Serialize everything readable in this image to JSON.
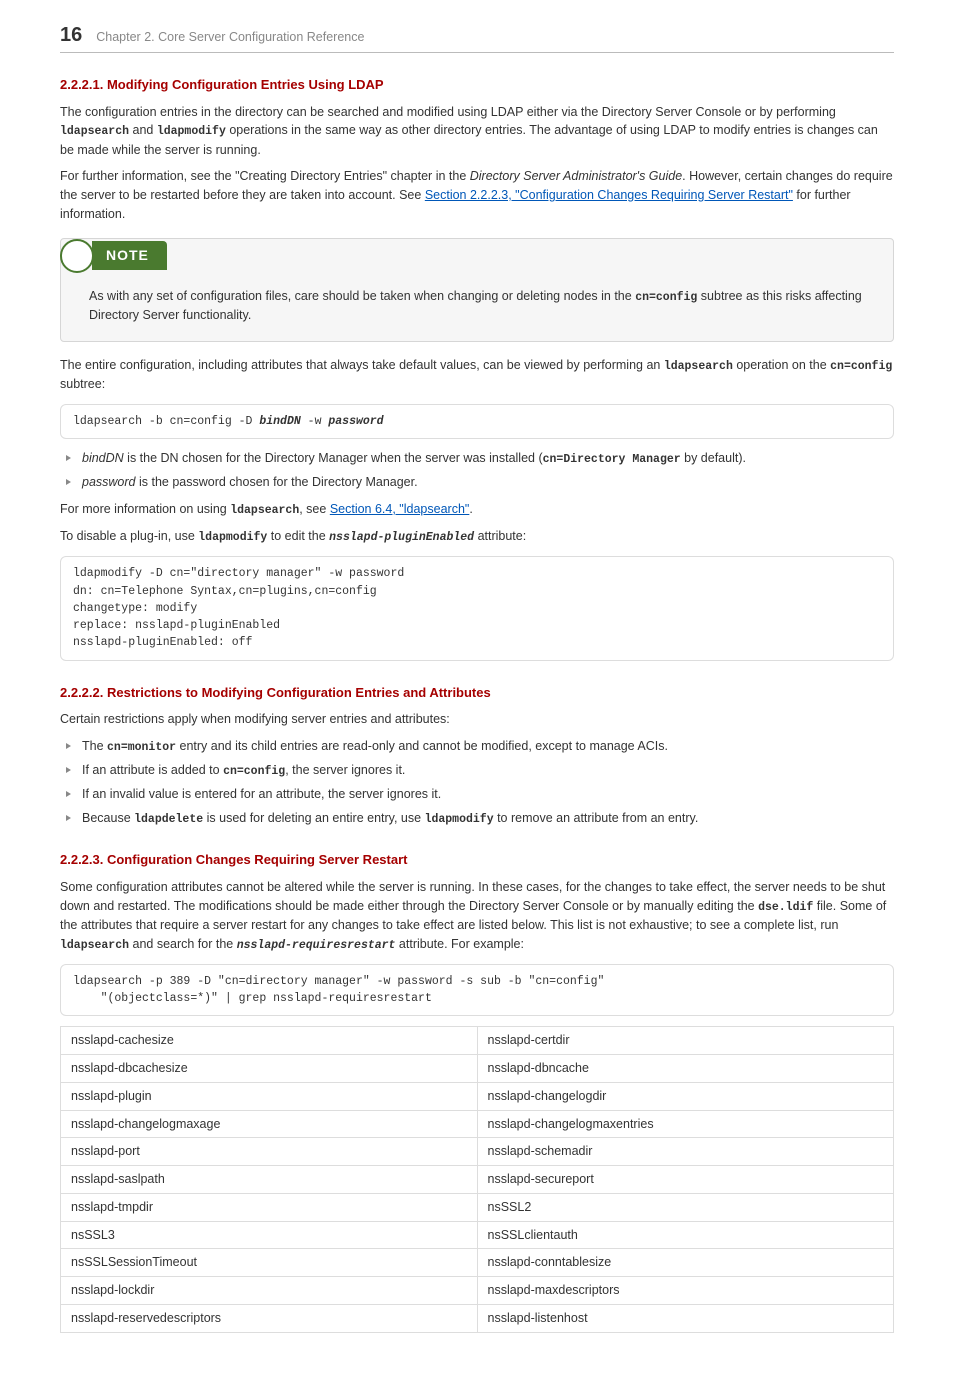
{
  "header": {
    "page_number": "16",
    "chapter": "Chapter 2. Core Server Configuration Reference"
  },
  "s1": {
    "title": "2.2.2.1. Modifying Configuration Entries Using LDAP",
    "p1a": "The configuration entries in the directory can be searched and modified using LDAP either via the Directory Server Console or by performing ",
    "p1b": "ldapsearch",
    "p1c": " and ",
    "p1d": "ldapmodify",
    "p1e": " operations in the same way as other directory entries. The advantage of using LDAP to modify entries is changes can be made while the server is running.",
    "p2a": "For further information, see the \"Creating Directory Entries\" chapter in the ",
    "p2b": "Directory Server Administrator's Guide",
    "p2c": ". However, certain changes do require the server to be restarted before they are taken into account. See ",
    "p2link": "Section 2.2.2.3, \"Configuration Changes Requiring Server Restart\"",
    "p2d": " for further information.",
    "note_label": "NOTE",
    "note_a": "As with any set of configuration files, care should be taken when changing or deleting nodes in the ",
    "note_b": "cn=config",
    "note_c": " subtree as this risks affecting Directory Server functionality.",
    "p3a": "The entire configuration, including attributes that always take default values, can be viewed by performing an ",
    "p3b": "ldapsearch",
    "p3c": " operation on the ",
    "p3d": "cn=config",
    "p3e": " subtree:",
    "code1a": "ldapsearch -b cn=config -D ",
    "code1b": "bindDN",
    "code1c": " -w ",
    "code1d": "password",
    "li1a": "bindDN",
    "li1b": " is the DN chosen for the Directory Manager when the server was installed (",
    "li1c": "cn=Directory Manager",
    "li1d": " by default).",
    "li2a": "password",
    "li2b": " is the password chosen for the Directory Manager.",
    "p4a": "For more information on using ",
    "p4b": "ldapsearch",
    "p4c": ", see ",
    "p4link": "Section 6.4, \"ldapsearch\"",
    "p4d": ".",
    "p5a": "To disable a plug-in, use ",
    "p5b": "ldapmodify",
    "p5c": " to edit the ",
    "p5d": "nsslapd-pluginEnabled",
    "p5e": " attribute:",
    "code2": "ldapmodify -D cn=\"directory manager\" -w password\ndn: cn=Telephone Syntax,cn=plugins,cn=config\nchangetype: modify\nreplace: nsslapd-pluginEnabled\nnsslapd-pluginEnabled: off"
  },
  "s2": {
    "title": "2.2.2.2. Restrictions to Modifying Configuration Entries and Attributes",
    "p1": "Certain restrictions apply when modifying server entries and attributes:",
    "li1a": "The ",
    "li1b": "cn=monitor",
    "li1c": " entry and its child entries are read-only and cannot be modified, except to manage ACIs.",
    "li2a": "If an attribute is added to ",
    "li2b": "cn=config",
    "li2c": ", the server ignores it.",
    "li3": "If an invalid value is entered for an attribute, the server ignores it.",
    "li4a": "Because ",
    "li4b": "ldapdelete",
    "li4c": " is used for deleting an entire entry, use ",
    "li4d": "ldapmodify",
    "li4e": " to remove an attribute from an entry."
  },
  "s3": {
    "title": "2.2.2.3. Configuration Changes Requiring Server Restart",
    "p1a": "Some configuration attributes cannot be altered while the server is running. In these cases, for the changes to take effect, the server needs to be shut down and restarted. The modifications should be made either through the Directory Server Console or by manually editing the ",
    "p1b": "dse.ldif",
    "p1c": " file. Some of the attributes that require a server restart for any changes to take effect are listed below. This list is not exhaustive; to see a complete list, run ",
    "p1d": "ldapsearch",
    "p1e": " and search for the ",
    "p1f": "nsslapd-requiresrestart",
    "p1g": " attribute. For example:",
    "code1": "ldapsearch -p 389 -D \"cn=directory manager\" -w password -s sub -b \"cn=config\"\n    \"(objectclass=*)\" | grep nsslapd-requiresrestart",
    "table": [
      [
        "nsslapd-cachesize",
        "nsslapd-certdir"
      ],
      [
        "nsslapd-dbcachesize",
        "nsslapd-dbncache"
      ],
      [
        "nsslapd-plugin",
        "nsslapd-changelogdir"
      ],
      [
        "nsslapd-changelogmaxage",
        "nsslapd-changelogmaxentries"
      ],
      [
        "nsslapd-port",
        "nsslapd-schemadir"
      ],
      [
        "nsslapd-saslpath",
        "nsslapd-secureport"
      ],
      [
        "nsslapd-tmpdir",
        "nsSSL2"
      ],
      [
        "nsSSL3",
        "nsSSLclientauth"
      ],
      [
        "nsSSLSessionTimeout",
        "nsslapd-conntablesize"
      ],
      [
        "nsslapd-lockdir",
        "nsslapd-maxdescriptors"
      ],
      [
        "nsslapd-reservedescriptors",
        "nsslapd-listenhost"
      ]
    ]
  }
}
